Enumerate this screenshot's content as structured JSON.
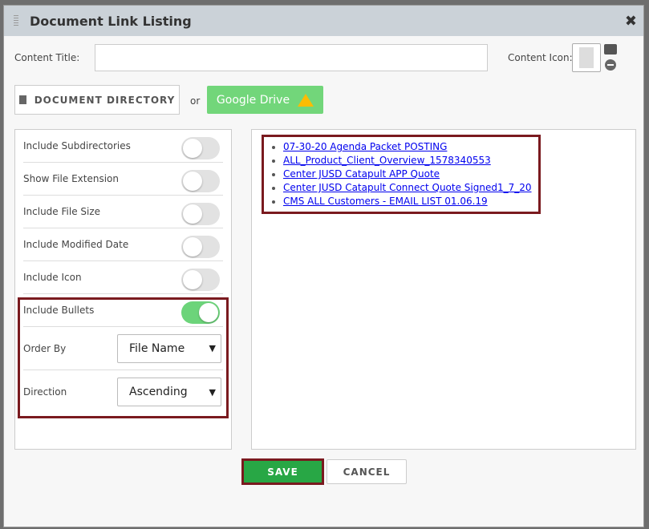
{
  "dialog": {
    "title": "Document Link Listing"
  },
  "form": {
    "content_title_label": "Content Title:",
    "content_title_value": "",
    "content_icon_label": "Content Icon:"
  },
  "source": {
    "document_directory": "DOCUMENT DIRECTORY",
    "or": "or",
    "google_drive": "Google Drive"
  },
  "options": [
    {
      "label": "Include Subdirectories",
      "on": false
    },
    {
      "label": "Show File Extension",
      "on": false
    },
    {
      "label": "Include File Size",
      "on": false
    },
    {
      "label": "Include Modified Date",
      "on": false
    },
    {
      "label": "Include Icon",
      "on": false
    },
    {
      "label": "Include Bullets",
      "on": true
    }
  ],
  "order_by": {
    "label": "Order By",
    "value": "File Name"
  },
  "direction": {
    "label": "Direction",
    "value": "Ascending"
  },
  "preview_links": [
    "07-30-20 Agenda Packet POSTING",
    "ALL_Product_Client_Overview_1578340553",
    "Center JUSD Catapult APP Quote",
    "Center JUSD Catapult Connect Quote Signed1_7_20",
    "CMS ALL Customers - EMAIL LIST 01.06.19"
  ],
  "actions": {
    "save": "SAVE",
    "cancel": "CANCEL"
  },
  "colors": {
    "highlight": "#7a1a1f",
    "save": "#28a745",
    "google_drive": "#72d67a",
    "toggle_on": "#6cd47a"
  }
}
